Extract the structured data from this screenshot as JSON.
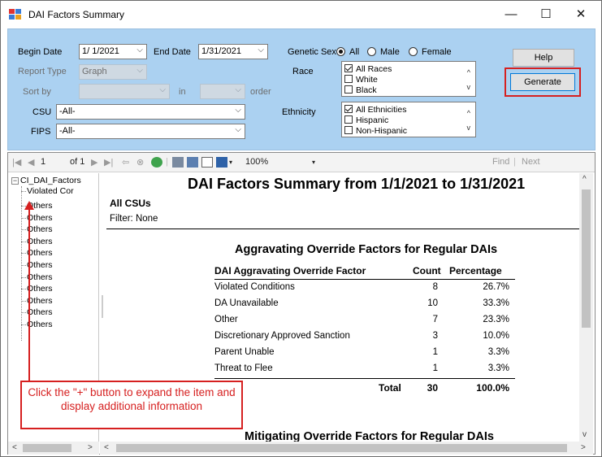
{
  "window": {
    "title": "DAI Factors Summary",
    "controls": {
      "minimize": "—",
      "maximize": "☐",
      "close": "✕"
    }
  },
  "filters": {
    "begin_date_label": "Begin Date",
    "begin_date_value": "1/ 1/2021",
    "end_date_label": "End Date",
    "end_date_value": "1/31/2021",
    "report_type_label": "Report Type",
    "report_type_value": "Graph",
    "sort_by_label": "Sort by",
    "sort_in_label": "in",
    "sort_order_label": "order",
    "csu_label": "CSU",
    "csu_value": "-All-",
    "fips_label": "FIPS",
    "fips_value": "-All-",
    "genetic_sex_label": "Genetic Sex",
    "genetic_sex_options": [
      "All",
      "Male",
      "Female"
    ],
    "genetic_sex_selected": "All",
    "race_label": "Race",
    "race_items": [
      "All Races",
      "White",
      "Black"
    ],
    "ethnicity_label": "Ethnicity",
    "ethnicity_items": [
      "All Ethnicities",
      "Hispanic",
      "Non-Hispanic"
    ],
    "help_button": "Help",
    "generate_button": "Generate"
  },
  "toolbar": {
    "page_current": "1",
    "page_of": "of 1",
    "zoom": "100%",
    "find": "Find",
    "separator": "|",
    "next": "Next"
  },
  "doc_map": {
    "root": "CI_DAI_Factors",
    "items": [
      "Violated Cor",
      "Others",
      "Others",
      "Others",
      "Others",
      "Others",
      "Others",
      "Others",
      "Others",
      "Others",
      "Others",
      "Others"
    ]
  },
  "report": {
    "title": "DAI Factors Summary from 1/1/2021 to 1/31/2021",
    "csu_heading": "All CSUs",
    "filter_text": "Filter: None",
    "section1_title": "Aggravating Override Factors for Regular DAIs",
    "columns": [
      "DAI Aggravating Override Factor",
      "Count",
      "Percentage"
    ],
    "rows": [
      {
        "factor": "Violated Conditions",
        "count": "8",
        "pct": "26.7%"
      },
      {
        "factor": "DA Unavailable",
        "count": "10",
        "pct": "33.3%"
      },
      {
        "factor": "Other",
        "count": "7",
        "pct": "23.3%"
      },
      {
        "factor": "Discretionary Approved Sanction",
        "count": "3",
        "pct": "10.0%"
      },
      {
        "factor": "Parent Unable",
        "count": "1",
        "pct": "3.3%"
      },
      {
        "factor": "Threat to Flee",
        "count": "1",
        "pct": "3.3%"
      }
    ],
    "total_label": "Total",
    "total_count": "30",
    "total_pct": "100.0%",
    "section2_title": "Mitigating Override Factors for Regular DAIs"
  },
  "callout": {
    "text": "Click the \"+\" button to expand the item and display additional information"
  },
  "colors": {
    "panel_bg": "#abd1f1",
    "highlight_red": "#d62020",
    "button_bg": "#e1e1e1"
  }
}
